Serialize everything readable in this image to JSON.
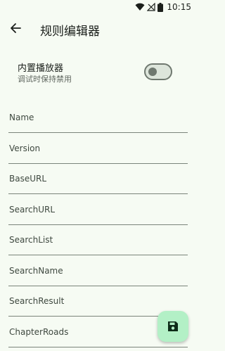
{
  "status_bar": {
    "time": "10:15"
  },
  "app_bar": {
    "title": "规则编辑器"
  },
  "settings": {
    "builtin_player": {
      "title": "内置播放器",
      "subtitle": "调试时保持禁用",
      "enabled": false
    }
  },
  "fields": [
    {
      "label": "Name"
    },
    {
      "label": "Version"
    },
    {
      "label": "BaseURL"
    },
    {
      "label": "SearchURL"
    },
    {
      "label": "SearchList"
    },
    {
      "label": "SearchName"
    },
    {
      "label": "SearchResult"
    },
    {
      "label": "ChapterRoads"
    }
  ],
  "colors": {
    "background": "#f6fbf3",
    "fab": "#b3f0c6",
    "fab_icon": "#0d2b17"
  },
  "icons": {
    "back": "arrow-back-icon",
    "save": "save-icon",
    "wifi": "wifi-icon",
    "signal": "signal-off-icon",
    "battery": "battery-icon"
  }
}
